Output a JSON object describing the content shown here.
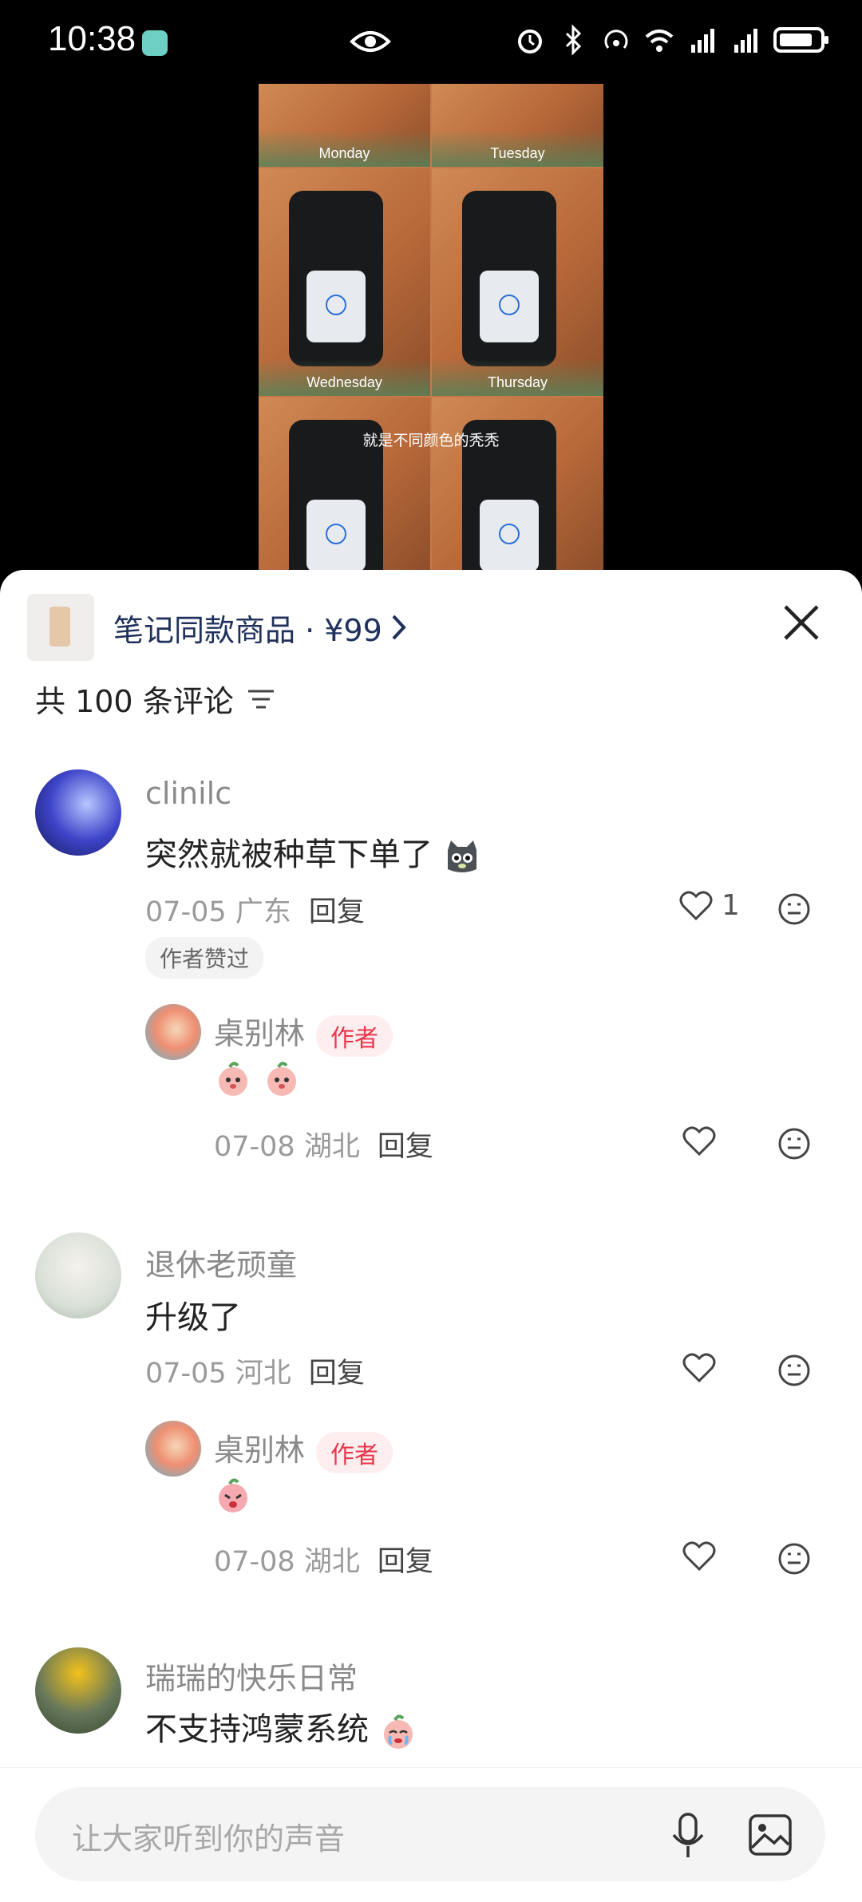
{
  "status_bar": {
    "time": "10:38"
  },
  "video": {
    "days": [
      "Monday",
      "Tuesday",
      "Wednesday",
      "Thursday"
    ],
    "caption": "就是不同颜色的秃秃"
  },
  "product": {
    "label": "笔记同款商品 · ¥99"
  },
  "comment_count": "共 100 条评论",
  "comments": [
    {
      "user": "clinilc",
      "text": "突然就被种草下单了",
      "date_location": "07-05 广东",
      "reply_label": "回复",
      "like_count": "1",
      "badge": "作者赞过",
      "reply": {
        "user": "桌别林",
        "tag": "作者",
        "date_location": "07-08 湖北",
        "reply_label": "回复"
      }
    },
    {
      "user": "退休老顽童",
      "text": "升级了",
      "date_location": "07-05 河北",
      "reply_label": "回复",
      "reply": {
        "user": "桌别林",
        "tag": "作者",
        "date_location": "07-08 湖北",
        "reply_label": "回复"
      }
    },
    {
      "user": "瑞瑞的快乐日常",
      "text": "不支持鸿蒙系统"
    }
  ],
  "input": {
    "placeholder": "让大家听到你的声音"
  }
}
